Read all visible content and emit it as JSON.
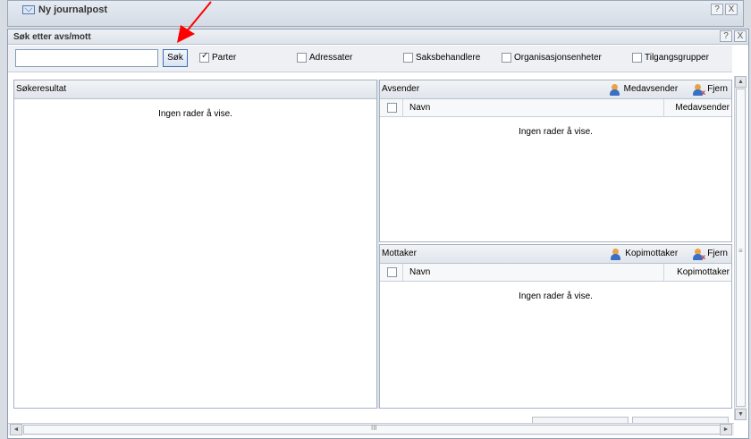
{
  "background_window": {
    "title": "Ny journalpost",
    "help_button": "?",
    "close_button": "X"
  },
  "dialog": {
    "title": "Søk etter avs/mott",
    "help_button": "?",
    "close_button": "X"
  },
  "toolbar": {
    "search_value": "",
    "search_button": "Søk",
    "checkboxes": [
      {
        "label": "Parter",
        "checked": true
      },
      {
        "label": "Adressater",
        "checked": false
      },
      {
        "label": "Saksbehandlere",
        "checked": false
      },
      {
        "label": "Organisasjonsenheter",
        "checked": false
      },
      {
        "label": "Tilgangsgrupper",
        "checked": false
      }
    ]
  },
  "results": {
    "title": "Søkeresultat",
    "empty_text": "Ingen rader å vise."
  },
  "sender": {
    "title": "Avsender",
    "action_add": "Medavsender",
    "action_remove": "Fjern",
    "columns": [
      "Navn",
      "Medavsender"
    ],
    "empty_text": "Ingen rader å vise."
  },
  "recipient": {
    "title": "Mottaker",
    "action_add": "Kopimottaker",
    "action_remove": "Fjern",
    "columns": [
      "Navn",
      "Kopimottaker"
    ],
    "empty_text": "Ingen rader å vise."
  },
  "scrollbars": {
    "up": "▲",
    "down": "▼",
    "left": "◄",
    "right": "►",
    "grip_v": "≡",
    "grip_h": "III"
  },
  "colors": {
    "annotation_arrow": "#ff0000",
    "accent": "#3c6fb3"
  }
}
